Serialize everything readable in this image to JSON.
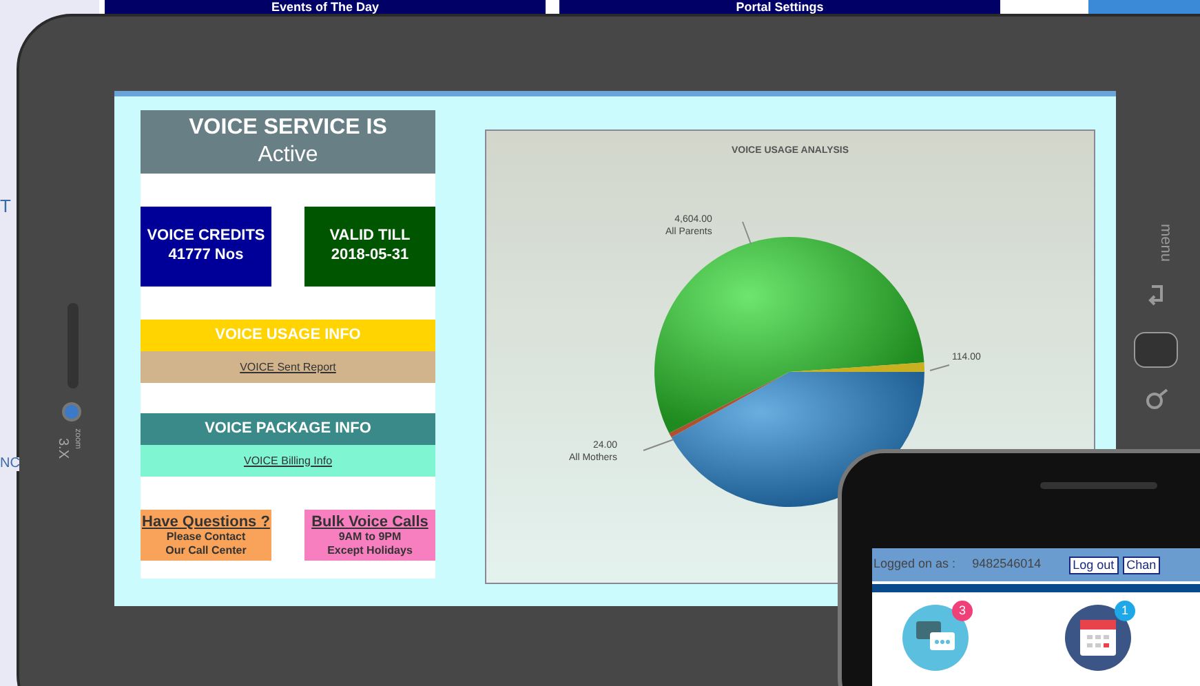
{
  "background": {
    "header_tabs": [
      "Events of The Day",
      "Portal Settings"
    ],
    "edge_fragments": [
      "T",
      "NC"
    ]
  },
  "tablet": {
    "side_labels": [
      "3.X",
      "zoom",
      "menu"
    ]
  },
  "status": {
    "title": "VOICE SERVICE IS",
    "value": "Active"
  },
  "tiles": [
    {
      "title": "VOICE CREDITS",
      "value": "41777 Nos",
      "color": "#000099"
    },
    {
      "title": "VALID TILL",
      "value": "2018-05-31",
      "color": "#005500"
    }
  ],
  "sections": [
    {
      "kind": "usage",
      "title": "VOICE USAGE INFO",
      "link": "VOICE Sent Report",
      "color": "#ffd400"
    },
    {
      "kind": "package",
      "title": "VOICE PACKAGE INFO",
      "link": "VOICE Billing Info",
      "color": "#3b8a8a"
    }
  ],
  "info_boxes": [
    {
      "title": "Have Questions ?",
      "lines": [
        "Please Contact",
        "Our Call Center"
      ],
      "color": "#f9a35a"
    },
    {
      "title": "Bulk Voice Calls",
      "lines": [
        "9AM to 9PM",
        "Except Holidays"
      ],
      "color": "#f77fc0"
    }
  ],
  "chart": {
    "title": "VOICE USAGE ANALYSIS",
    "labels": [
      {
        "value": "4,604.00",
        "name": "All Parents"
      },
      {
        "value": "24.00",
        "name": "All Mothers"
      },
      {
        "value": "114.00"
      }
    ]
  },
  "phone": {
    "logged_label": "Logged on as :",
    "user": "9482546014",
    "buttons": [
      "Log out",
      "Chan"
    ],
    "apps": [
      {
        "kind": "messages",
        "badge": "3"
      },
      {
        "kind": "events",
        "badge": "1"
      }
    ]
  }
}
